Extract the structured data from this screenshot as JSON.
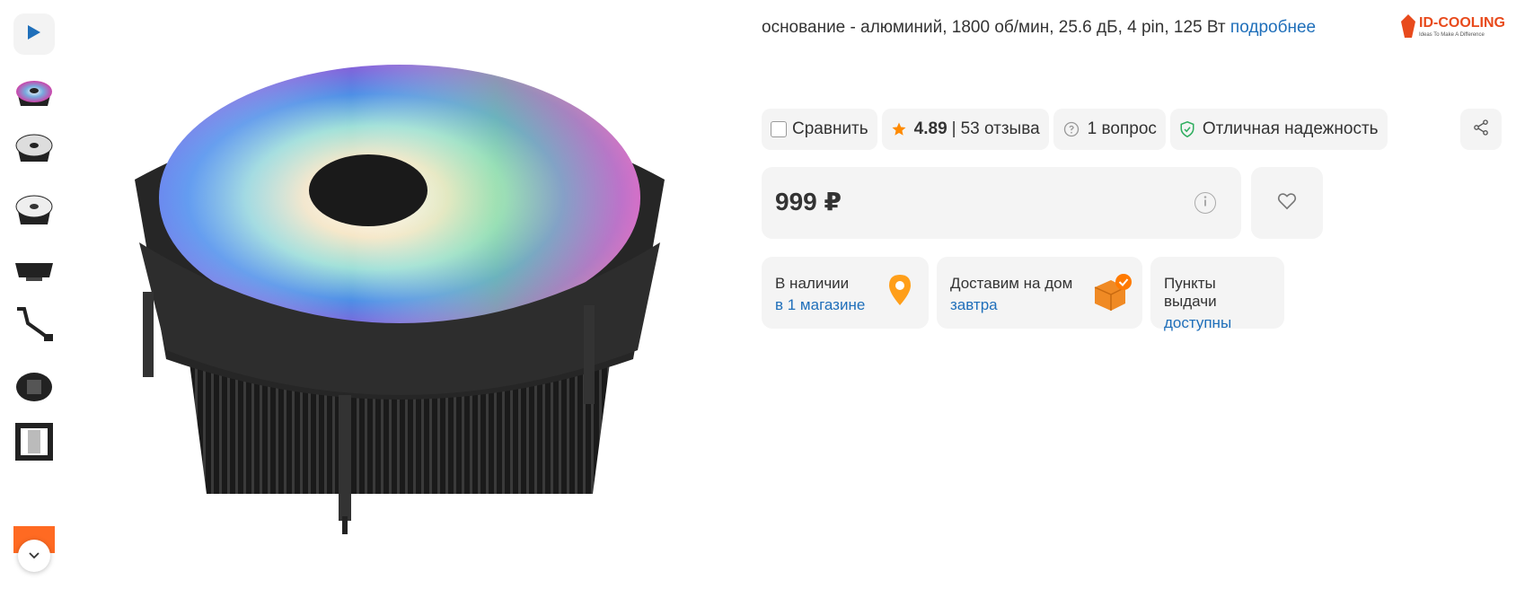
{
  "product": {
    "short_specs": "основание - алюминий, 1800 об/мин, 25.6 дБ, 4 pin, 125 Вт",
    "more_link": "подробнее",
    "brand_logo_text": "ID-COOLING",
    "brand_tagline": "Ideas To Make A Difference"
  },
  "actions": {
    "compare_label": "Сравнить",
    "rating_value": "4.89",
    "rating_separator": "|",
    "reviews_label": "53 отзыва",
    "questions_label": "1 вопрос",
    "reliability_label": "Отличная надежность"
  },
  "price": {
    "value": "999 ₽"
  },
  "availability": [
    {
      "title": "В наличии",
      "link": "в 1 магазине"
    },
    {
      "title": "Доставим на дом",
      "link": "завтра"
    },
    {
      "title": "Пункты выдачи",
      "link": "доступны"
    }
  ],
  "colors": {
    "link": "#1f6fba",
    "accent_orange": "#ff8a00",
    "pill_bg": "#f4f4f4",
    "shield_green": "#2fae5f"
  },
  "icons": {
    "video": "play-icon",
    "star": "star-icon",
    "question": "question-bubble-icon",
    "shield": "shield-check-icon",
    "share": "share-icon",
    "info": "info-icon",
    "wishlist": "heart-icon",
    "pin": "map-pin-icon",
    "box": "delivery-box-icon",
    "scroll_down": "chevron-down-icon"
  }
}
